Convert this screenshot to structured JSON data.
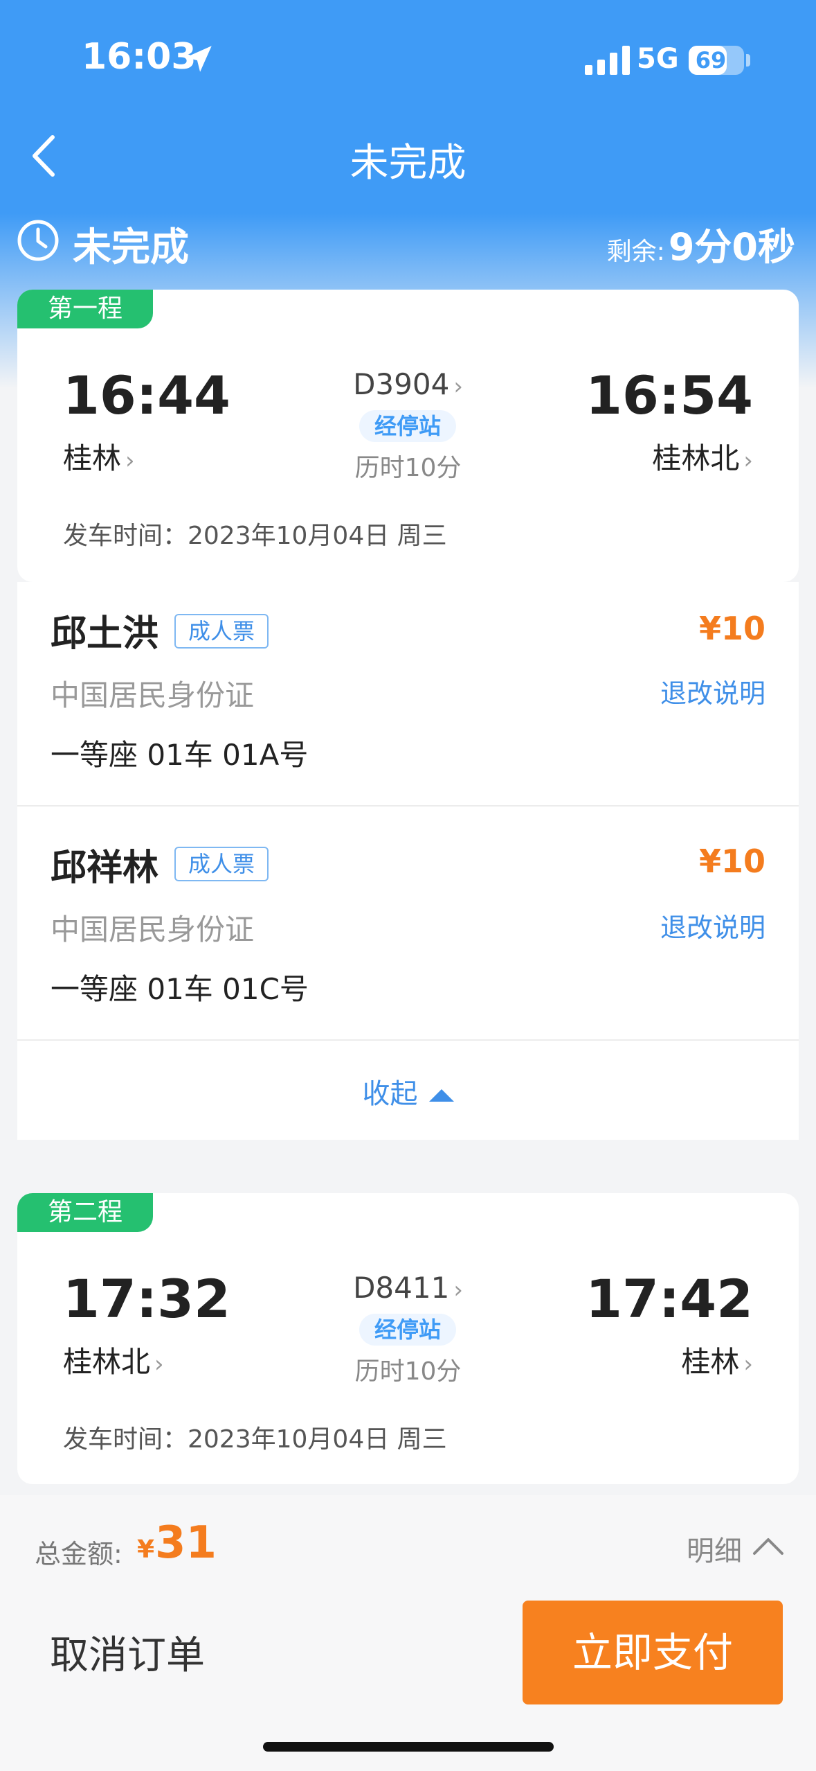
{
  "status_bar": {
    "time": "16:03",
    "network": "5G",
    "battery": "69",
    "battery_level": 0.69
  },
  "nav": {
    "title": "未完成"
  },
  "order_status": {
    "title": "未完成",
    "remaining_label": "剩余:",
    "remaining_value": "9分0秒"
  },
  "legs": [
    {
      "tag": "第一程",
      "dep_time": "16:44",
      "dep_station": "桂林",
      "arr_time": "16:54",
      "arr_station": "桂林北",
      "train_no": "D3904",
      "stops_label": "经停站",
      "duration": "历时10分",
      "depart_date": "发车时间：2023年10月04日 周三"
    },
    {
      "tag": "第二程",
      "dep_time": "17:32",
      "dep_station": "桂林北",
      "arr_time": "17:42",
      "arr_station": "桂林",
      "train_no": "D8411",
      "stops_label": "经停站",
      "duration": "历时10分",
      "depart_date": "发车时间：2023年10月04日 周三"
    }
  ],
  "passengers": [
    {
      "name": "邱土洪",
      "type": "成人票",
      "price": "¥10",
      "id_type": "中国居民身份证",
      "refund": "退改说明",
      "seat": "一等座 01车 01A号"
    },
    {
      "name": "邱祥林",
      "type": "成人票",
      "price": "¥10",
      "id_type": "中国居民身份证",
      "refund": "退改说明",
      "seat": "一等座 01车 01C号"
    }
  ],
  "collapse_label": "收起",
  "footer": {
    "total_label": "总金额:",
    "currency": "¥",
    "total_value": "31",
    "detail_label": "明细",
    "cancel_label": "取消订单",
    "pay_label": "立即支付"
  },
  "icons": {
    "location": "location-arrow-icon",
    "signal": "signal-icon",
    "back": "chevron-left-icon",
    "clock": "clock-icon",
    "collapse": "triangle-up-icon",
    "detail": "chevron-up-icon"
  },
  "colors": {
    "header_blue": "#3f9bf6",
    "green_tag": "#25c070",
    "price_orange": "#f47c1e",
    "pay_button": "#f7811f",
    "link_blue": "#3f8fe8"
  }
}
